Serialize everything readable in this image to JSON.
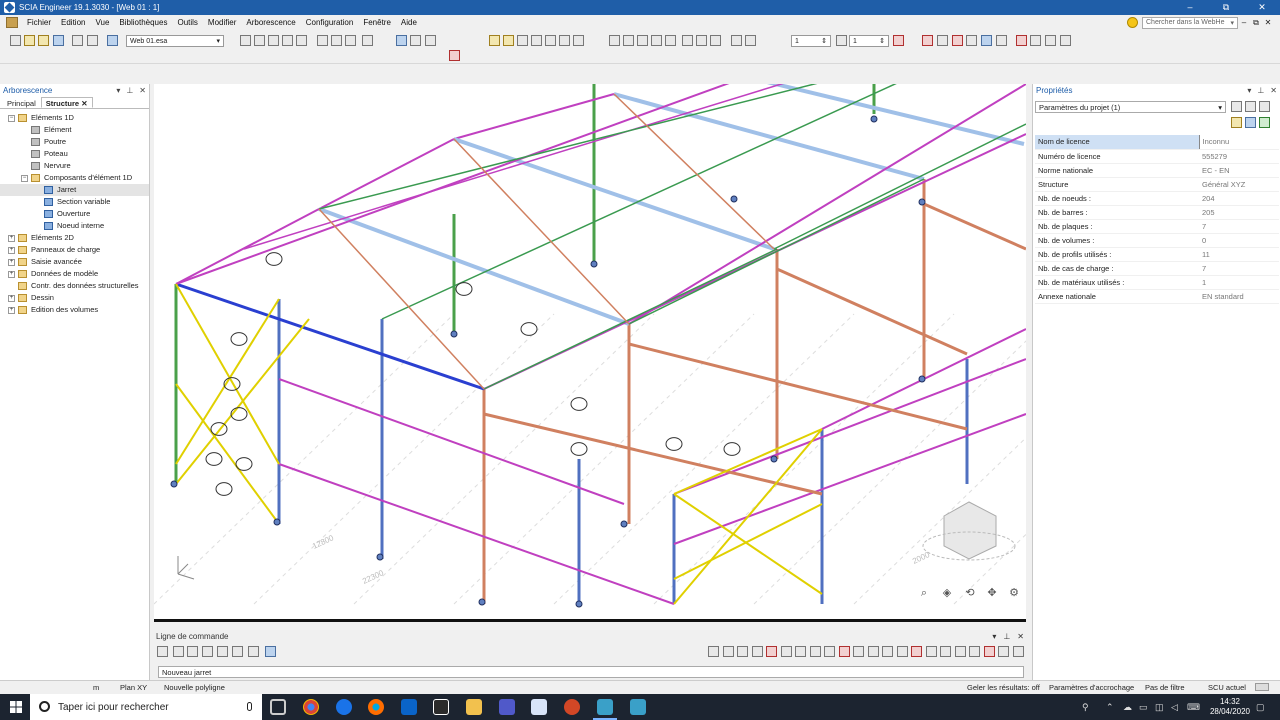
{
  "window": {
    "title": "SCIA Engineer 19.1.3030 - [Web 01 : 1]",
    "buttons": [
      "–",
      "⧉",
      "✕"
    ],
    "mdi_buttons": [
      "–",
      "⧉",
      "✕"
    ]
  },
  "menu": {
    "items": [
      "Fichier",
      "Edition",
      "Vue",
      "Bibliothèques",
      "Outils",
      "Modifier",
      "Arborescence",
      "Configuration",
      "Fenêtre",
      "Aide"
    ],
    "search_placeholder": "Chercher dans la WebHe"
  },
  "toolbar": {
    "file_combo": "Web 01.esa",
    "counter1": "1",
    "counter2": "1"
  },
  "left_panel": {
    "title": "Arborescence",
    "tabs": [
      "Principal",
      "Structure"
    ],
    "tree": [
      {
        "label": "Eléments 1D",
        "level": 0,
        "expander": "−"
      },
      {
        "label": "Elément",
        "level": 1
      },
      {
        "label": "Poutre",
        "level": 1
      },
      {
        "label": "Poteau",
        "level": 1
      },
      {
        "label": "Nervure",
        "level": 1
      },
      {
        "label": "Composants d'élément 1D",
        "level": 1,
        "expander": "−"
      },
      {
        "label": "Jarret",
        "level": 2,
        "selected": true
      },
      {
        "label": "Section variable",
        "level": 2
      },
      {
        "label": "Ouverture",
        "level": 2
      },
      {
        "label": "Noeud interne",
        "level": 2
      },
      {
        "label": "Eléments 2D",
        "level": 0,
        "expander": "+"
      },
      {
        "label": "Panneaux de charge",
        "level": 0,
        "expander": "+"
      },
      {
        "label": "Saisie avancée",
        "level": 0,
        "expander": "+"
      },
      {
        "label": "Données de modèle",
        "level": 0,
        "expander": "+"
      },
      {
        "label": "Contr. des données structurelles",
        "level": 0
      },
      {
        "label": "Dessin",
        "level": 0,
        "expander": "+"
      },
      {
        "label": "Edition des volumes",
        "level": 0,
        "expander": "+"
      }
    ]
  },
  "viewport": {
    "dim_labels": [
      "12800",
      "22300",
      "2000"
    ],
    "controls": [
      "zoom-icon",
      "view-cube-icon",
      "orbit-icon",
      "pan-icon",
      "settings-icon"
    ]
  },
  "command_panel": {
    "title": "Ligne de commande",
    "input_text": "Nouveau jarret"
  },
  "properties": {
    "title": "Propriétés",
    "selector": "Paramètres du projet (1)",
    "rows": [
      {
        "key": "Nom de licence",
        "value": "Inconnu"
      },
      {
        "key": "Numéro de licence",
        "value": "555279"
      },
      {
        "key": "Norme nationale",
        "value": "EC - EN"
      },
      {
        "key": "Structure",
        "value": "Général XYZ"
      },
      {
        "key": "Nb. de noeuds :",
        "value": "204"
      },
      {
        "key": "Nb. de barres :",
        "value": "205"
      },
      {
        "key": "Nb. de plaques :",
        "value": "7"
      },
      {
        "key": "Nb. de volumes :",
        "value": "0"
      },
      {
        "key": "Nb. de profils utilisés :",
        "value": "11"
      },
      {
        "key": "Nb. de cas de charge :",
        "value": "7"
      },
      {
        "key": "Nb. de matériaux utilisés :",
        "value": "1"
      },
      {
        "key": "Annexe nationale",
        "value": "EN standard"
      }
    ]
  },
  "status_bar": {
    "unit": "m",
    "plane": "Plan XY",
    "mode": "Nouvelle polyligne",
    "freeze": "Geler les résultats: off",
    "snap": "Paramètres d'accrochage",
    "filter": "Pas de filtre",
    "ucs": "SCU actuel"
  },
  "taskbar": {
    "search_placeholder": "Taper ici pour rechercher",
    "time": "14:32",
    "date": "28/04/2020"
  },
  "colors": {
    "title_bar": "#1f5ea8",
    "selection": "#cfe0f4",
    "beam_blue": "#2a3fd0",
    "beam_pink": "#c040c0",
    "bracing_yellow": "#e0d000",
    "column_orange": "#d08060",
    "column_green": "#4aa04a"
  }
}
